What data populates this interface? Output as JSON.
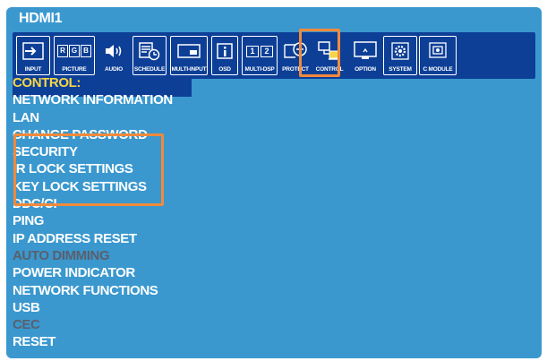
{
  "screen": {
    "source": "HDMI1"
  },
  "toolbar": {
    "tabs": [
      {
        "label": "INPUT",
        "icon": "input-icon"
      },
      {
        "label": "PICTURE",
        "icon": "picture-rgb-icon"
      },
      {
        "label": "AUDIO",
        "icon": "speaker-icon"
      },
      {
        "label": "SCHEDULE",
        "icon": "schedule-icon"
      },
      {
        "label": "MULTI-INPUT",
        "icon": "multi-input-icon"
      },
      {
        "label": "OSD",
        "icon": "osd-info-icon"
      },
      {
        "label": "MULTI-DSP",
        "icon": "multi-display-icon"
      },
      {
        "label": "PROTECT",
        "icon": "protect-icon"
      },
      {
        "label": "CONTROL",
        "icon": "control-icon",
        "active": true
      },
      {
        "label": "OPTION",
        "icon": "option-icon"
      },
      {
        "label": "SYSTEM",
        "icon": "system-gear-icon"
      },
      {
        "label": "C MODULE",
        "icon": "c-module-icon"
      }
    ],
    "picture_letters": [
      "R",
      "G",
      "B"
    ],
    "multi_dsp_digits": [
      "1",
      "2"
    ]
  },
  "menu": {
    "heading": "CONTROL:",
    "items": [
      {
        "label": "NETWORK INFORMATION",
        "enabled": true
      },
      {
        "label": "LAN",
        "enabled": true
      },
      {
        "label": "CHANGE PASSWORD",
        "enabled": true
      },
      {
        "label": "SECURITY",
        "enabled": true
      },
      {
        "label": "IR LOCK SETTINGS",
        "enabled": true
      },
      {
        "label": "KEY LOCK SETTINGS",
        "enabled": true
      },
      {
        "label": "DDC/CI",
        "enabled": true
      },
      {
        "label": "PING",
        "enabled": true
      },
      {
        "label": "IP ADDRESS RESET",
        "enabled": true
      },
      {
        "label": "AUTO DIMMING",
        "enabled": false
      },
      {
        "label": "POWER INDICATOR",
        "enabled": true
      },
      {
        "label": "NETWORK FUNCTIONS",
        "enabled": true
      },
      {
        "label": "USB",
        "enabled": true
      },
      {
        "label": "CEC",
        "enabled": false
      },
      {
        "label": "RESET",
        "enabled": true
      }
    ]
  },
  "colors": {
    "background": "#3a98cf",
    "toolbar": "#0d3f97",
    "heading": "#f5d547",
    "text": "#ffffff",
    "disabled": "#5a5f6c",
    "highlight": "#f08a3c",
    "active_icon": "#f5d547"
  }
}
